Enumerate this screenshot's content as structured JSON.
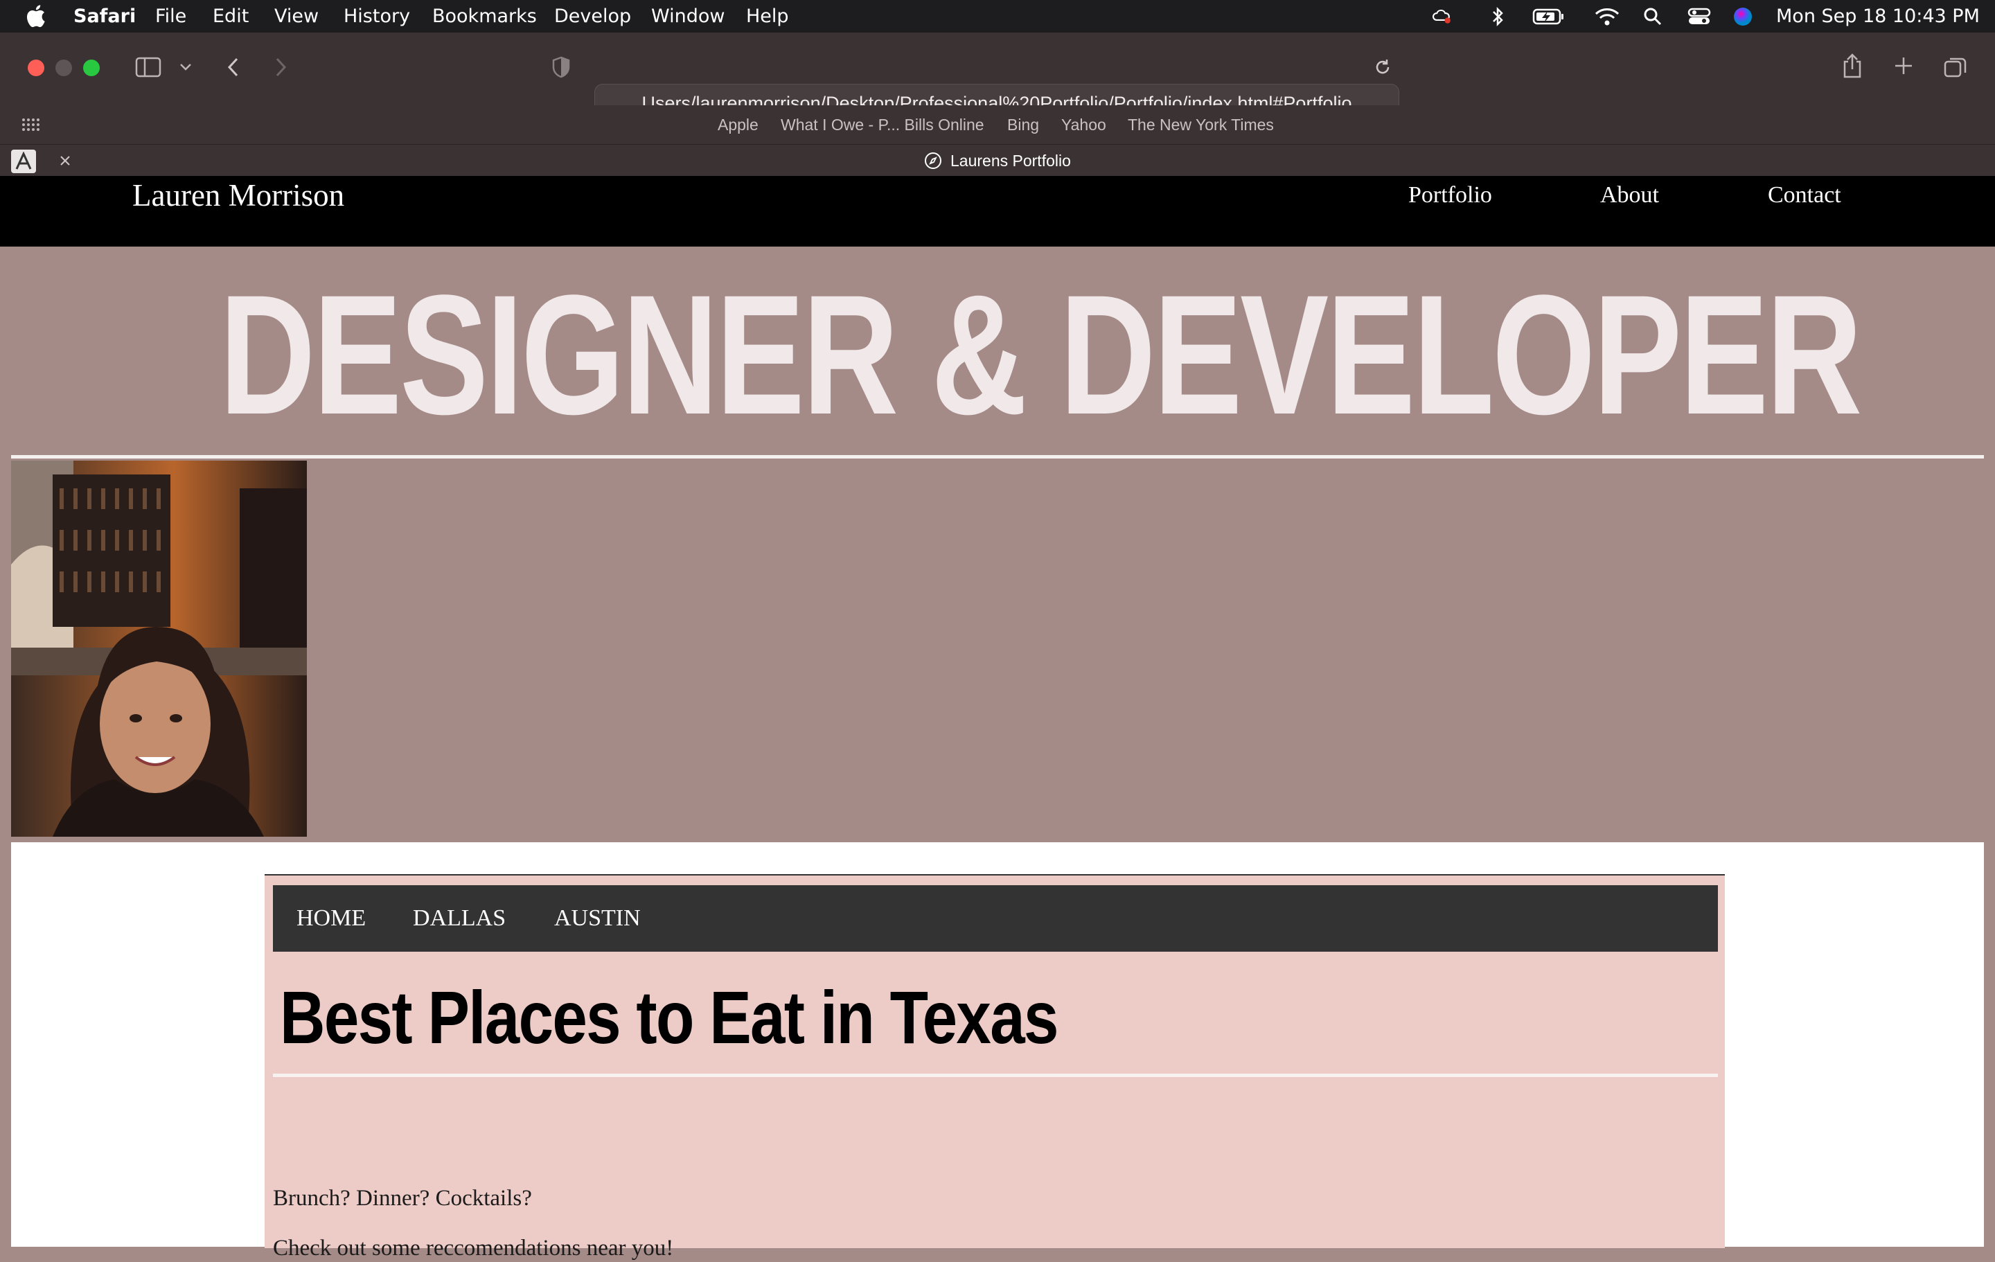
{
  "menubar": {
    "app": "Safari",
    "items": [
      "File",
      "Edit",
      "View",
      "History",
      "Bookmarks",
      "Develop",
      "Window",
      "Help"
    ],
    "clock": "Mon Sep 18  10:43 PM"
  },
  "browser": {
    "url": "Users/laurenmorrison/Desktop/Professional%20Portfolio/Portfolio/index.html#Portfolio",
    "bookmarks": [
      "Apple",
      "What I Owe - P... Bills Online",
      "Bing",
      "Yahoo",
      "The New York Times"
    ],
    "tab_title": "Laurens Portfolio"
  },
  "site": {
    "brand": "Lauren Morrison",
    "nav": [
      "Portfolio",
      "About",
      "Contact"
    ],
    "hero_title": "DESIGNER & DEVELOPER"
  },
  "panel": {
    "subnav": [
      "HOME",
      "DALLAS",
      "AUSTIN"
    ],
    "title": "Best Places to Eat in Texas",
    "lines": [
      "Brunch? Dinner? Cocktails?",
      "Check out some reccomendations near you!"
    ]
  },
  "colors": {
    "hero_bg": "#a58b87",
    "panel_bg": "#edcbc6",
    "subnav_bg": "#333333"
  }
}
